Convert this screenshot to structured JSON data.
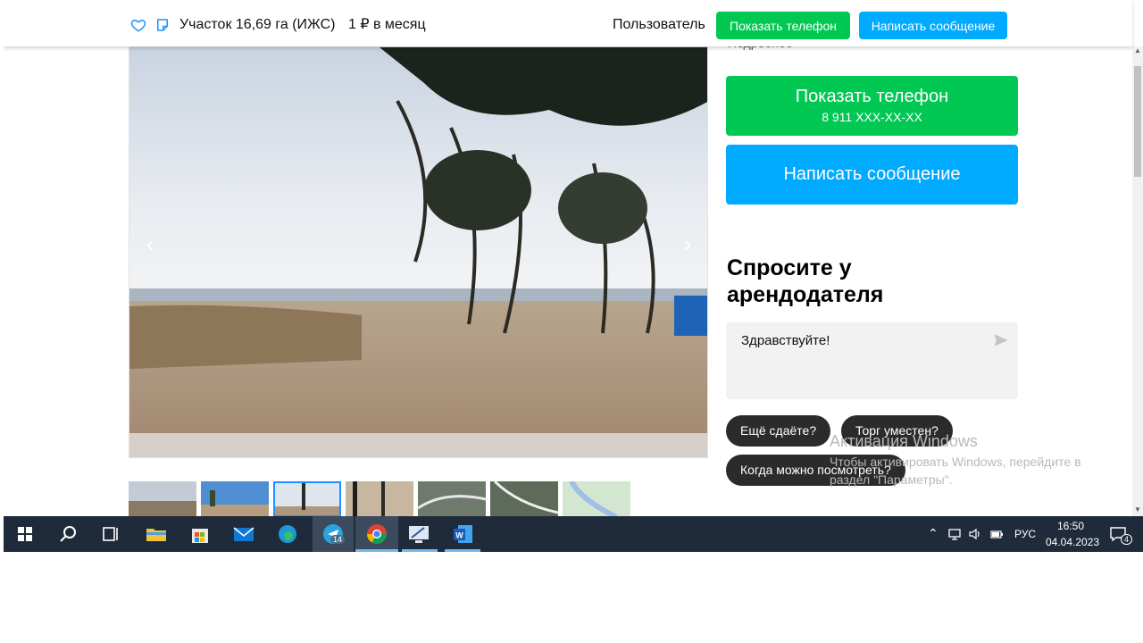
{
  "header": {
    "title": "Участок 16,69 га (ИЖС)",
    "price": "1 ₽ в месяц",
    "user": "Пользователь",
    "show_phone": "Показать телефон",
    "write_message": "Написать сообщение"
  },
  "sidebar": {
    "cut_text": "Подробнее",
    "phone_label": "Показать телефон",
    "phone_number": "8 911 XXX-XX-XX",
    "message_label": "Написать сообщение",
    "ask_title": "Спросите у арендодателя",
    "message_input": "Здравствуйте!",
    "quick_replies": [
      "Ещё сдаёте?",
      "Торг уместен?",
      "Когда можно посмотреть?"
    ]
  },
  "gallery": {
    "prev": "‹",
    "next": "›",
    "active_thumb": 3
  },
  "watermark": {
    "title": "Активация Windows",
    "text": "Чтобы активировать Windows, перейдите в раздел \"Параметры\"."
  },
  "taskbar": {
    "telegram_badge": "14",
    "language": "РУС",
    "time": "16:50",
    "date": "04.04.2023",
    "notifications": "4"
  },
  "colors": {
    "green": "#00c853",
    "blue": "#00aaff",
    "chip": "#2b2b2b",
    "taskbar": "#1f2b3a"
  }
}
